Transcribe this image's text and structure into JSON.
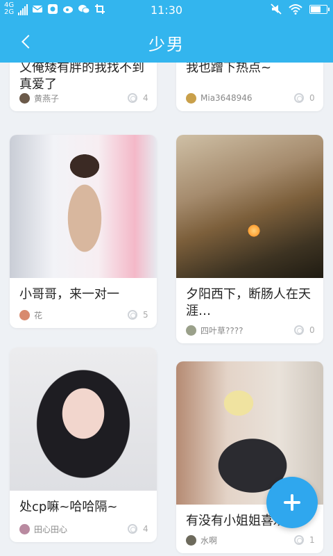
{
  "status": {
    "signal_top": "4G",
    "signal_bottom": "2G",
    "time": "11:30"
  },
  "header": {
    "title": "少男"
  },
  "posts": [
    {
      "title": "又俺矮有胖的我找不到真爱了",
      "author": "黄燕子",
      "count": "4",
      "avatar_color": "#6b5a4a"
    },
    {
      "title": "我也蹭下热点~",
      "author": "Mia3648946",
      "count": "0",
      "avatar_color": "#c9a04a"
    },
    {
      "title": "小哥哥，来一对一",
      "author": "花",
      "count": "5",
      "avatar_color": "#d88a6e"
    },
    {
      "title": "夕阳西下，断肠人在天涯…",
      "author": "四叶草????",
      "count": "0",
      "avatar_color": "#9aa08a"
    },
    {
      "title": "处cp嘛~哈哈隔~",
      "author": "田心田心",
      "count": "4",
      "avatar_color": "#b98aa0"
    },
    {
      "title": "有没有小姐姐喜欢我",
      "author": "水啊",
      "count": "1",
      "avatar_color": "#6d6a5c"
    }
  ],
  "colors": {
    "accent": "#33b5ee",
    "fab": "#2fa7ee",
    "background": "#eef1f5"
  }
}
